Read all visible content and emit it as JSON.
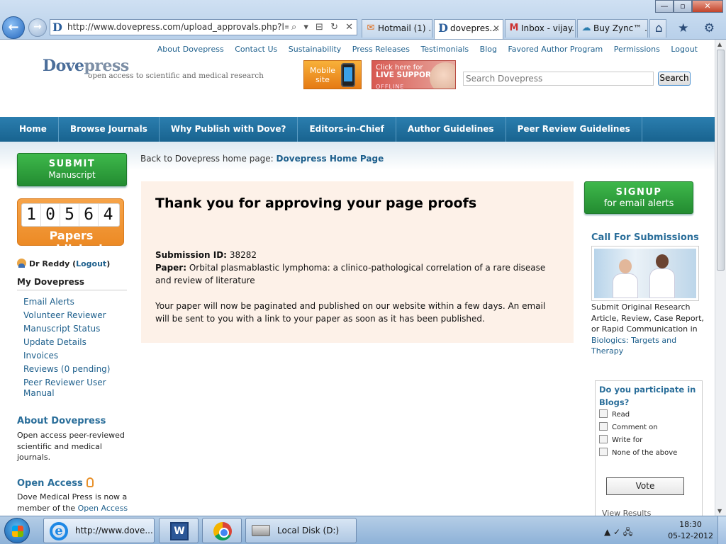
{
  "browser": {
    "url": "http://www.dovepress.com/upload_approvals.php?l=xQYeIK",
    "address_tools": "⌕ ▾ ⊟ ↻ ✕",
    "tabs": [
      {
        "label": "Hotmail (1) ...",
        "icon": "hotmail-icon",
        "active": false
      },
      {
        "label": "dovepres...",
        "icon": "dovepress-favicon",
        "active": true
      },
      {
        "label": "Inbox - vijay...",
        "icon": "gmail-icon",
        "active": false
      },
      {
        "label": "Buy Zync™ ...",
        "icon": "zync-icon",
        "active": false
      }
    ],
    "window_controls": {
      "minimize": "—",
      "maximize": "▫",
      "close": "✕"
    },
    "toolbar_icons": "⌂ ★ ⚙"
  },
  "header": {
    "top_links": [
      "About Dovepress",
      "Contact Us",
      "Sustainability",
      "Press Releases",
      "Testimonials",
      "Blog",
      "Favored Author Program",
      "Permissions",
      "Logout"
    ],
    "logo_name_part1": "Dove",
    "logo_name_part2": "press",
    "logo_tagline": "open access to scientific and medical research",
    "mobile_banner": "Mobile site",
    "live_support_line1": "Click here for",
    "live_support_line2": "LIVE SUPPORT",
    "live_support_status": "OFFLINE",
    "search_placeholder": "Search Dovepress",
    "search_button": "Search"
  },
  "nav": {
    "items": [
      "Home",
      "Browse Journals",
      "Why Publish with Dove?",
      "Editors-in-Chief",
      "Author Guidelines",
      "Peer Review Guidelines"
    ]
  },
  "left": {
    "submit_line1": "SUBMIT",
    "submit_line2": "Manuscript",
    "counter_digits": [
      "1",
      "0",
      "5",
      "6",
      "4"
    ],
    "counter_label": "Papers published",
    "user_name": "Dr Reddy",
    "logout_label": "Logout",
    "my_dovepress": "My Dovepress",
    "links": [
      "Email Alerts",
      "Volunteer Reviewer",
      "Manuscript Status",
      "Update Details",
      "Invoices",
      "Reviews (0 pending)",
      "Peer Reviewer User Manual"
    ],
    "about_head": "About Dovepress",
    "about_text": "Open access peer-reviewed scientific and medical journals.",
    "oa_head": "Open Access",
    "oa_text_pre": "Dove Medical Press is now a member of the ",
    "oa_text_link": "Open Access"
  },
  "main": {
    "back_text": "Back to Dovepress home page:",
    "back_link": "Dovepress Home Page",
    "title": "Thank you for approving your page proofs",
    "submission_label": "Submission ID:",
    "submission_id": "38282",
    "paper_label": "Paper:",
    "paper_title": "Orbital plasmablastic lymphoma: a clinico-pathological correlation of a rare disease and review of literature",
    "message": "Your paper will now be paginated and published on our website within a few days. An email will be sent to you with a link to your paper as soon as it has been published."
  },
  "right": {
    "signup_line1": "SIGNUP",
    "signup_line2": "for email alerts",
    "cfs_head": "Call For Submissions",
    "cfs_text": "Submit Original Research Article, Review, Case Report, or Rapid Communication in ",
    "cfs_link": "Biologics: Targets and Therapy",
    "poll_question": "Do you participate in Blogs?",
    "poll_options": [
      "Read",
      "Comment on",
      "Write for",
      "None of the above"
    ],
    "vote_button": "Vote",
    "view_results": "View Results"
  },
  "taskbar": {
    "ie_label": "http://www.dove...",
    "word_glyph": "W",
    "disk_label": "Local Disk (D:)",
    "tray_icons": "▲ ✓ 🖧",
    "time": "18:30",
    "date": "05-12-2012"
  }
}
